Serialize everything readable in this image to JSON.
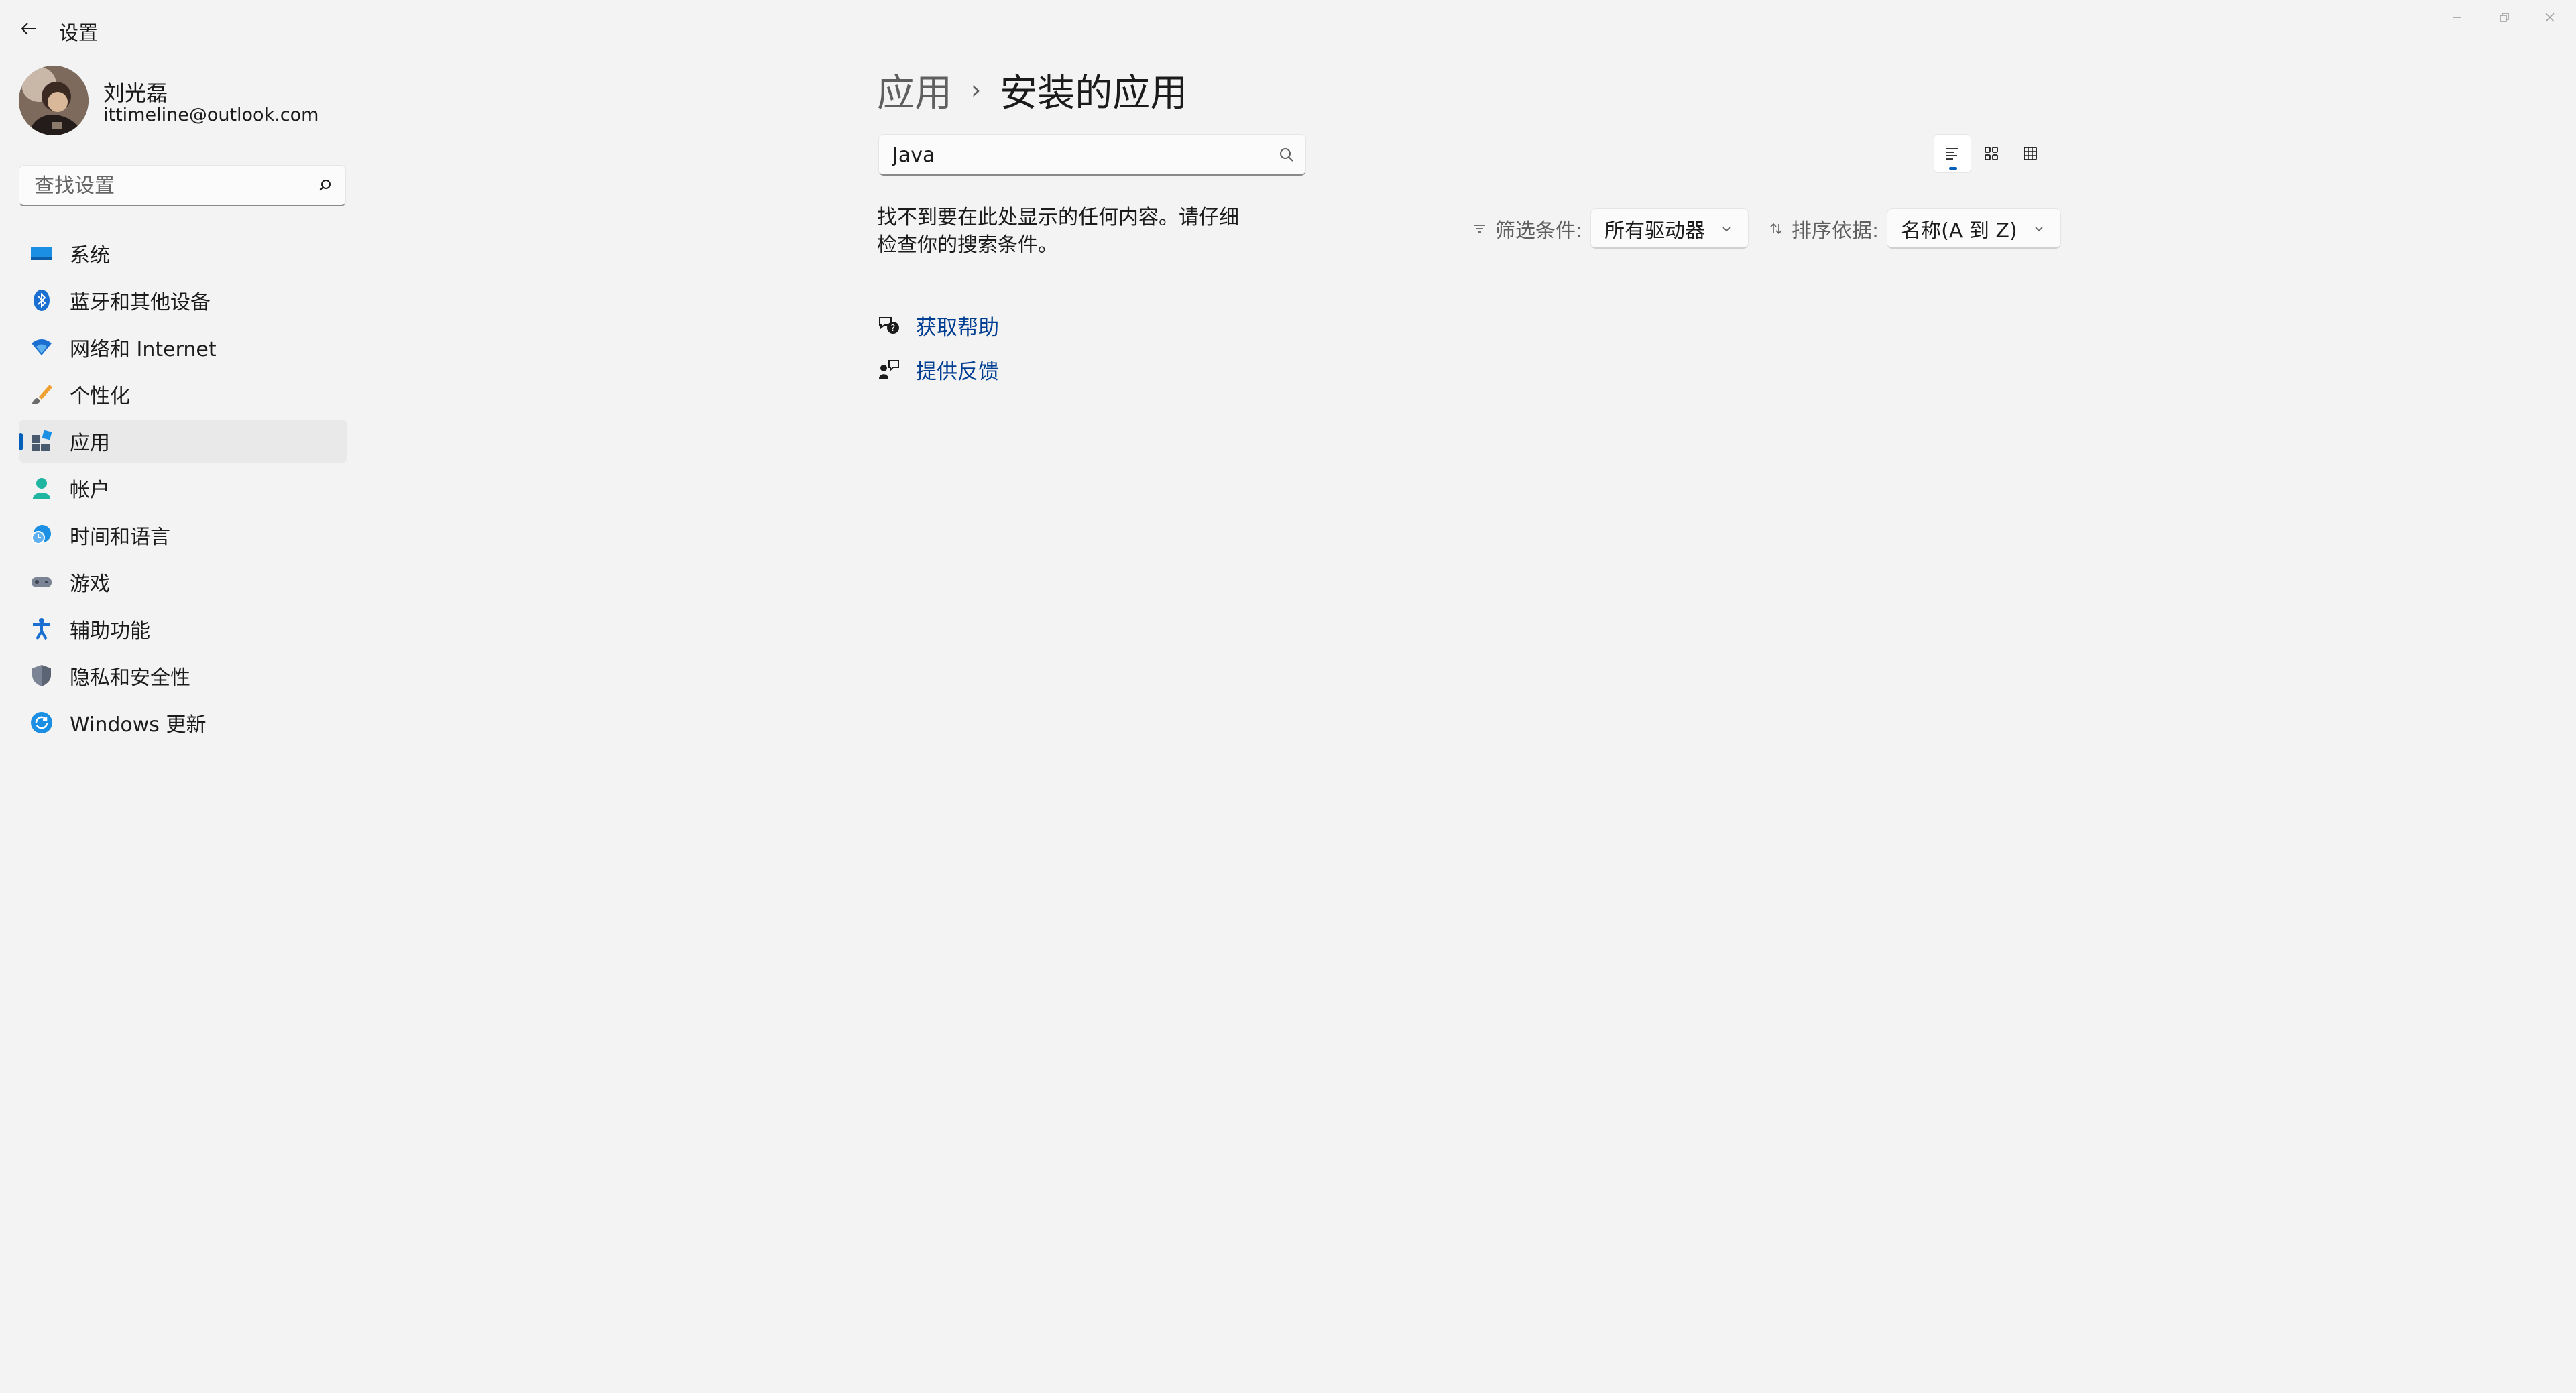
{
  "window": {
    "title": "设置"
  },
  "profile": {
    "name": "刘光磊",
    "email": "ittimeline@outlook.com"
  },
  "sidebar": {
    "search_placeholder": "查找设置",
    "items": [
      {
        "label": "系统",
        "icon": "monitor-icon",
        "selected": false
      },
      {
        "label": "蓝牙和其他设备",
        "icon": "bluetooth-icon",
        "selected": false
      },
      {
        "label": "网络和 Internet",
        "icon": "wifi-icon",
        "selected": false
      },
      {
        "label": "个性化",
        "icon": "paintbrush-icon",
        "selected": false
      },
      {
        "label": "应用",
        "icon": "apps-icon",
        "selected": true
      },
      {
        "label": "帐户",
        "icon": "person-icon",
        "selected": false
      },
      {
        "label": "时间和语言",
        "icon": "globe-clock-icon",
        "selected": false
      },
      {
        "label": "游戏",
        "icon": "gamepad-icon",
        "selected": false
      },
      {
        "label": "辅助功能",
        "icon": "accessibility-icon",
        "selected": false
      },
      {
        "label": "隐私和安全性",
        "icon": "shield-icon",
        "selected": false
      },
      {
        "label": "Windows 更新",
        "icon": "update-icon",
        "selected": false
      }
    ]
  },
  "main": {
    "breadcrumb": {
      "parent": "应用",
      "separator": "›",
      "current": "安装的应用"
    },
    "search": {
      "value": "Java"
    },
    "empty_message": "找不到要在此处显示的任何内容。请仔细检查你的搜索条件。",
    "filter": {
      "label": "筛选条件:",
      "value": "所有驱动器"
    },
    "sort": {
      "label": "排序依据:",
      "value": "名称(A 到 Z)"
    },
    "links": {
      "help": "获取帮助",
      "feedback": "提供反馈"
    },
    "view_modes": [
      "list-view-icon",
      "tile-view-icon",
      "grid-view-icon"
    ],
    "active_view": "list-view-icon"
  },
  "colors": {
    "accent": "#005fb8",
    "link": "#003e92",
    "background": "#f3f3f3"
  }
}
